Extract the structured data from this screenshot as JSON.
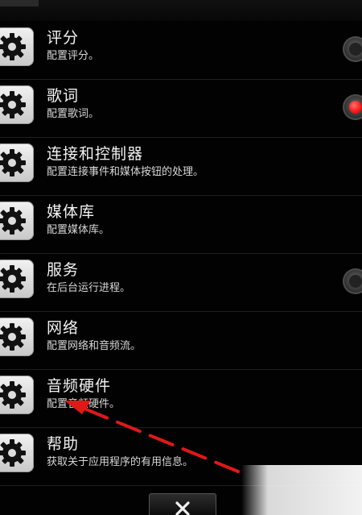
{
  "settings": {
    "items": [
      {
        "title": "评分",
        "subtitle": "配置评分。",
        "radio": "off"
      },
      {
        "title": "歌词",
        "subtitle": "配置歌词。",
        "radio": "on"
      },
      {
        "title": "连接和控制器",
        "subtitle": "配置连接事件和媒体按钮的处理。",
        "radio": "none"
      },
      {
        "title": "媒体库",
        "subtitle": "配置媒体库。",
        "radio": "none"
      },
      {
        "title": "服务",
        "subtitle": "在后台运行进程。",
        "radio": "off"
      },
      {
        "title": "网络",
        "subtitle": "配置网络和音频流。",
        "radio": "none"
      },
      {
        "title": "音频硬件",
        "subtitle": "配置音频硬件。",
        "radio": "none"
      },
      {
        "title": "帮助",
        "subtitle": "获取关于应用程序的有用信息。",
        "radio": "none"
      }
    ]
  },
  "icons": {
    "item_icon": "gear-icon",
    "close": "close-icon"
  },
  "colors": {
    "background": "#020202",
    "title_text": "#f2f2f2",
    "subtitle_text": "#d7d7d7",
    "radio_active": "#ff1a1a",
    "annotation_arrow": "#e01818"
  }
}
